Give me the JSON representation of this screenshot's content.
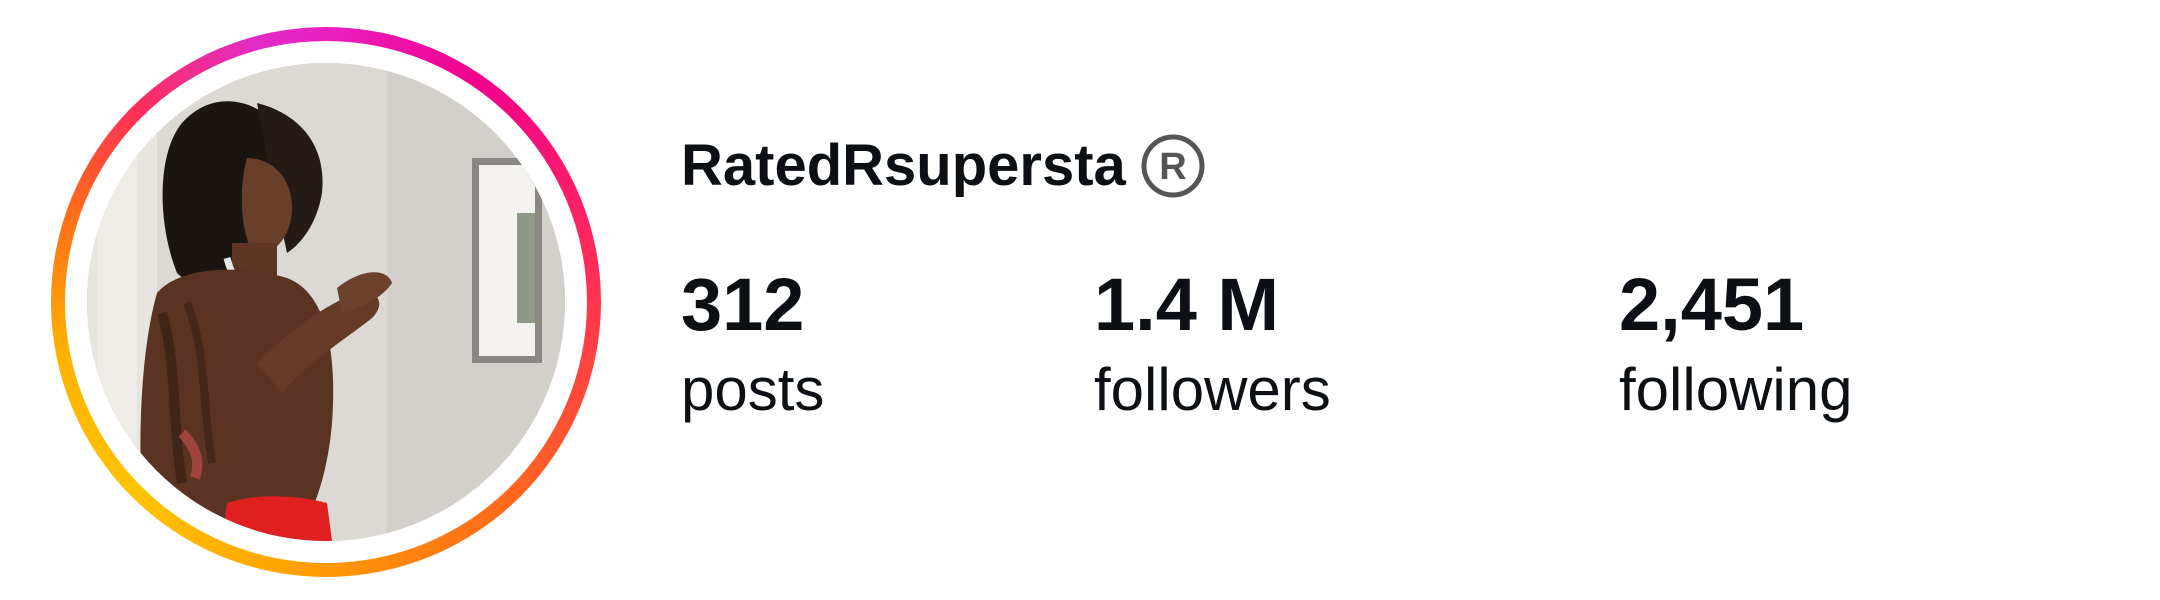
{
  "profile": {
    "username": "RatedRsupersta",
    "avatar_alt": "profile-photo",
    "story_ring": true,
    "badge_icon": "registered-trademark-icon"
  },
  "stats": {
    "posts": {
      "value": "312",
      "label": "posts"
    },
    "followers": {
      "value": "1.4 M",
      "label": "followers"
    },
    "following": {
      "value": "2,451",
      "label": "following"
    }
  },
  "colors": {
    "text": "#0c1014",
    "background": "#ffffff",
    "ring_gradient": [
      "#e91fbf",
      "#ff2a5a",
      "#ff6a1a",
      "#ffc400"
    ]
  }
}
